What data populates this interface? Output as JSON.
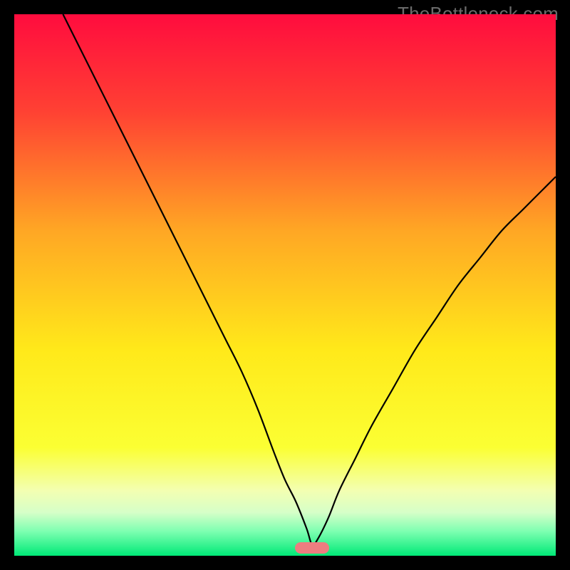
{
  "watermark": "TheBottleneck.com",
  "colors": {
    "frame": "#000000",
    "curve": "#000000",
    "marker": "#ed7d80",
    "gradient_stops": [
      {
        "offset": 0.0,
        "color": "#ff0c3e"
      },
      {
        "offset": 0.18,
        "color": "#ff4133"
      },
      {
        "offset": 0.4,
        "color": "#ffa724"
      },
      {
        "offset": 0.62,
        "color": "#ffe91a"
      },
      {
        "offset": 0.8,
        "color": "#fbff33"
      },
      {
        "offset": 0.88,
        "color": "#f3ffb2"
      },
      {
        "offset": 0.92,
        "color": "#d6ffc8"
      },
      {
        "offset": 0.955,
        "color": "#7dffb1"
      },
      {
        "offset": 1.0,
        "color": "#00e977"
      }
    ]
  },
  "chart_data": {
    "type": "line",
    "title": "",
    "xlabel": "",
    "ylabel": "",
    "xlim": [
      0,
      100
    ],
    "ylim": [
      0,
      100
    ],
    "grid": false,
    "legend": false,
    "min_x": 55,
    "min_y": 0,
    "series": [
      {
        "name": "curve",
        "x": [
          9,
          12,
          15,
          18,
          21,
          24,
          27,
          30,
          33,
          36,
          39,
          42,
          45,
          48,
          50,
          52,
          54,
          55,
          56,
          58,
          60,
          63,
          66,
          70,
          74,
          78,
          82,
          86,
          90,
          94,
          98,
          100
        ],
        "y": [
          100,
          94,
          88,
          82,
          76,
          70,
          64,
          58,
          52,
          46,
          40,
          34,
          27,
          19,
          14,
          10,
          5,
          2,
          3,
          7,
          12,
          18,
          24,
          31,
          38,
          44,
          50,
          55,
          60,
          64,
          68,
          70
        ]
      }
    ],
    "marker": {
      "x": 55,
      "y": 1.5
    }
  }
}
